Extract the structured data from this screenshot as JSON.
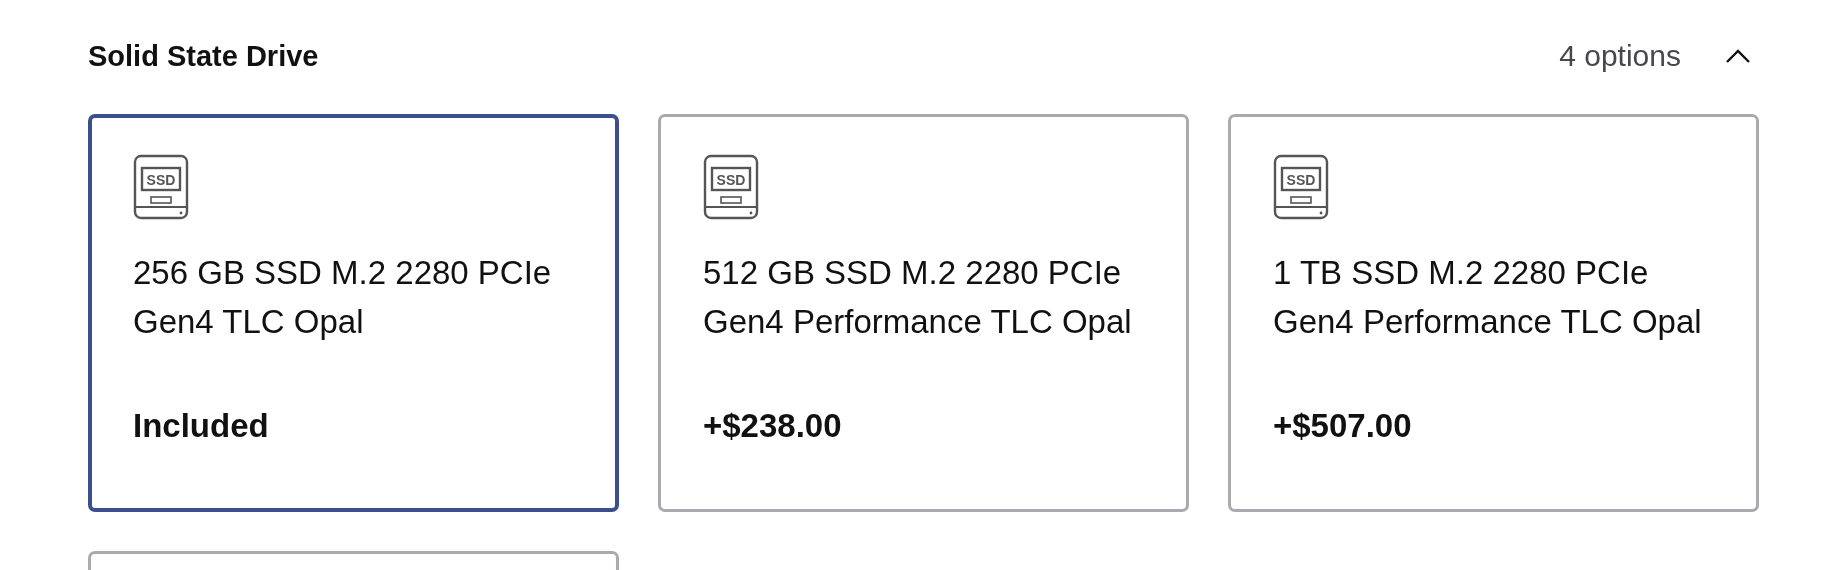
{
  "section": {
    "title": "Solid State Drive",
    "count": "4 options",
    "expanded": true
  },
  "options": [
    {
      "icon_label": "SSD",
      "name": "256 GB SSD M.2 2280 PCIe Gen4 TLC Opal",
      "price": "Included",
      "selected": true
    },
    {
      "icon_label": "SSD",
      "name": "512 GB SSD M.2 2280 PCIe Gen4 Performance TLC Opal",
      "price": "+$238.00",
      "selected": false
    },
    {
      "icon_label": "SSD",
      "name": "1 TB SSD M.2 2280 PCIe Gen4 Performance TLC Opal",
      "price": "+$507.00",
      "selected": false
    },
    {
      "selected": false
    }
  ]
}
